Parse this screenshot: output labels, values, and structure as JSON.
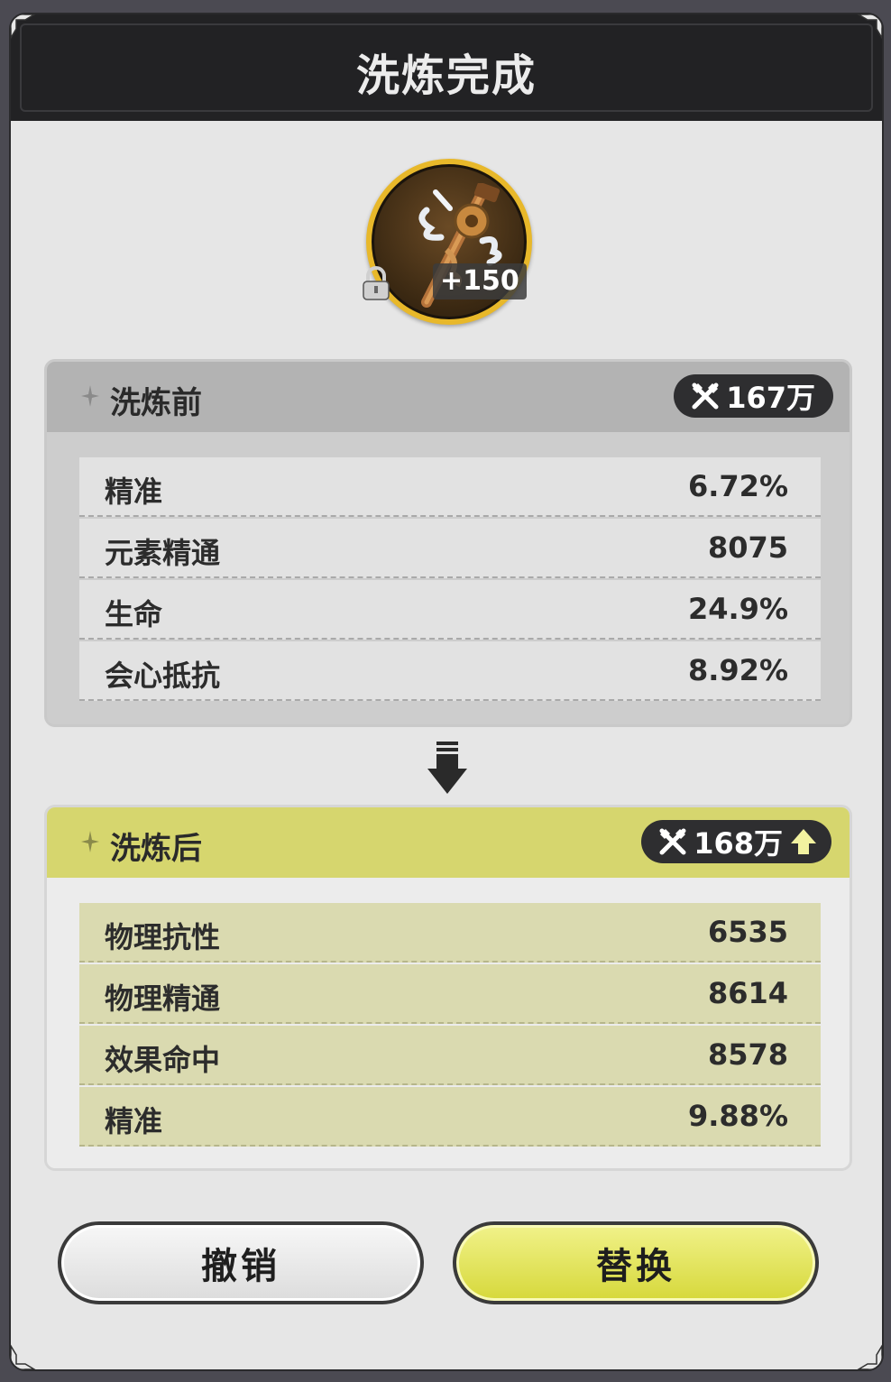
{
  "dialog": {
    "title": "洗炼完成"
  },
  "item": {
    "enhance_level": "+150",
    "locked": true,
    "icon": "ornate-staff-icon"
  },
  "before": {
    "label": "洗炼前",
    "power": "167万",
    "stats": [
      {
        "name": "精准",
        "value": "6.72%"
      },
      {
        "name": "元素精通",
        "value": "8075"
      },
      {
        "name": "生命",
        "value": "24.9%"
      },
      {
        "name": "会心抵抗",
        "value": "8.92%"
      }
    ]
  },
  "after": {
    "label": "洗炼后",
    "power": "168万",
    "power_trend": "up",
    "stats": [
      {
        "name": "物理抗性",
        "value": "6535"
      },
      {
        "name": "物理精通",
        "value": "8614"
      },
      {
        "name": "效果命中",
        "value": "8578"
      },
      {
        "name": "精准",
        "value": "9.88%"
      }
    ]
  },
  "buttons": {
    "cancel": "撤销",
    "replace": "替换"
  },
  "colors": {
    "accent": "#d6d66e",
    "title_bar": "#222224",
    "panel": "#e6e6e6"
  }
}
